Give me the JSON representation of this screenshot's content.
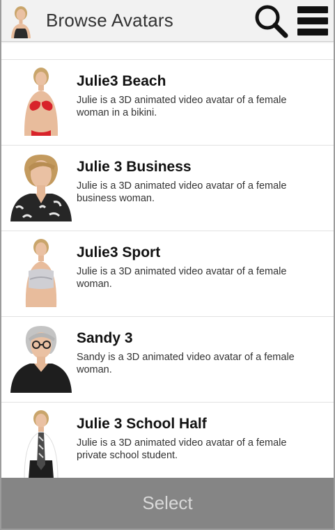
{
  "appbar": {
    "title": "Browse Avatars",
    "logo_icon": "avatar-logo-icon",
    "search_icon": "search-icon",
    "menu_icon": "menu-icon"
  },
  "avatars": [
    {
      "name": "Julie3 Beach",
      "desc_line1": "Julie is a 3D animated video avatar of a female",
      "desc_line2": "woman in a bikini.",
      "outfit": "bikini",
      "outfit_color": "#d8232a"
    },
    {
      "name": "Julie 3 Business",
      "desc_line1": "Julie is a 3D animated video avatar of a female",
      "desc_line2": "business woman.",
      "outfit": "business",
      "outfit_color": "#222222"
    },
    {
      "name": "Julie3 Sport",
      "desc_line1": "Julie is a 3D animated video avatar of a female",
      "desc_line2": "woman.",
      "outfit": "sport",
      "outfit_color": "#cfcfd4"
    },
    {
      "name": "Sandy 3",
      "desc_line1": "Sandy is a 3D animated video avatar of a female",
      "desc_line2": "woman.",
      "outfit": "jacket",
      "outfit_color": "#1e1e1e"
    },
    {
      "name": "Julie 3 School Half",
      "desc_line1": "Julie is a 3D animated video avatar of a female",
      "desc_line2": "private school student.",
      "outfit": "school",
      "outfit_color": "#ffffff"
    }
  ],
  "footer": {
    "select_label": "Select"
  },
  "colors": {
    "appbar_bg": "#f2f2f2",
    "select_bg": "#858585",
    "select_text": "#d9d9d9"
  }
}
